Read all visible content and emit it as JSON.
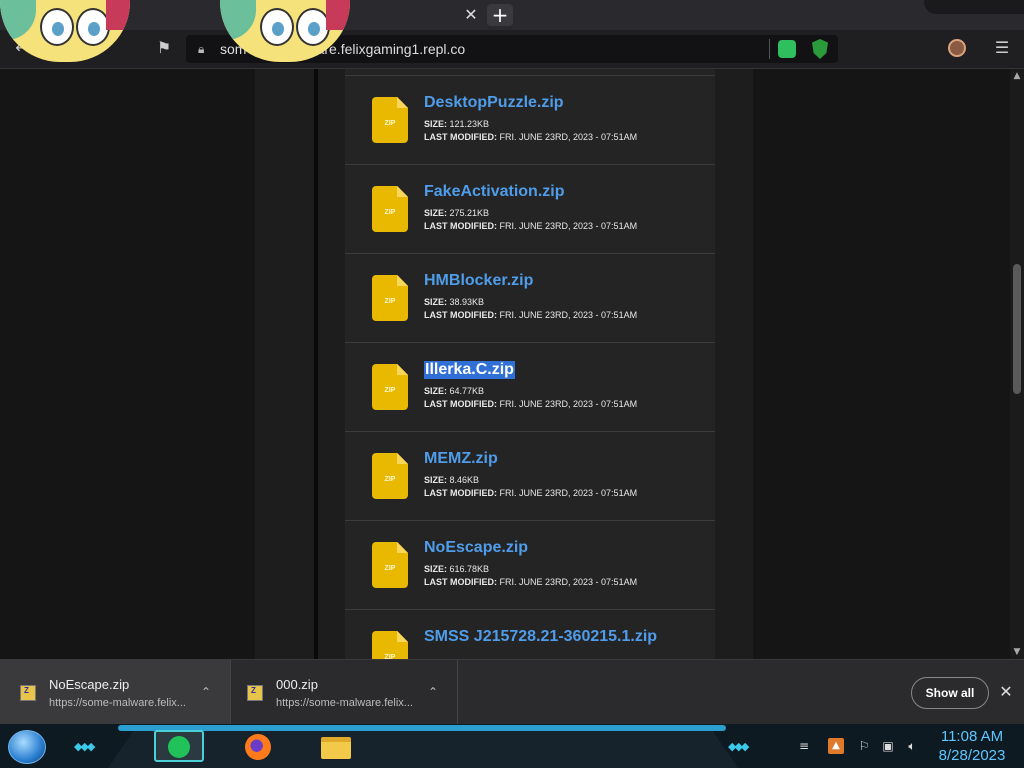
{
  "browser": {
    "url": "some-malware.felixgaming1.repl.co",
    "url_visible": "som",
    "url_visible_tail": "ware.felixgaming1.repl.co",
    "tab_close_symbol": "✕",
    "new_tab_symbol": "+",
    "icons": {
      "back": "arrow-left-icon",
      "reload": "reload-icon",
      "bookmark": "bookmark-icon",
      "lock": "lock-icon",
      "menu": "hamburger-menu-icon"
    }
  },
  "files": [
    {
      "name": "DesktopPuzzle.zip",
      "size": "121.23KB",
      "modified": "FRI. JUNE 23RD, 2023 - 07:51AM",
      "selected": false
    },
    {
      "name": "FakeActivation.zip",
      "size": "275.21KB",
      "modified": "FRI. JUNE 23RD, 2023 - 07:51AM",
      "selected": false
    },
    {
      "name": "HMBlocker.zip",
      "size": "38.93KB",
      "modified": "FRI. JUNE 23RD, 2023 - 07:51AM",
      "selected": false
    },
    {
      "name": "Illerka.C.zip",
      "size": "64.77KB",
      "modified": "FRI. JUNE 23RD, 2023 - 07:51AM",
      "selected": true
    },
    {
      "name": "MEMZ.zip",
      "size": "8.46KB",
      "modified": "FRI. JUNE 23RD, 2023 - 07:51AM",
      "selected": false
    },
    {
      "name": "NoEscape.zip",
      "size": "616.78KB",
      "modified": "FRI. JUNE 23RD, 2023 - 07:51AM",
      "selected": false
    },
    {
      "name": "SMSS J215728.21-360215.1.zip",
      "size": "",
      "modified": "",
      "selected": false
    }
  ],
  "labels": {
    "size": "SIZE:",
    "last_modified": "LAST MODIFIED:",
    "zip_icon_text": "ZIP"
  },
  "downloads": [
    {
      "name": "NoEscape.zip",
      "url": "https://some-malware.felix..."
    },
    {
      "name": "000.zip",
      "url": "https://some-malware.felix..."
    }
  ],
  "download_bar": {
    "show_all": "Show all",
    "close_symbol": "✕",
    "caret_symbol": "⌃"
  },
  "taskbar": {
    "time": "11:08 AM",
    "date": "8/28/2023"
  },
  "colors": {
    "link": "#4f9dea",
    "selection": "#2f6fd6",
    "zip_icon": "#e8b900",
    "clock": "#5fc6ff"
  }
}
